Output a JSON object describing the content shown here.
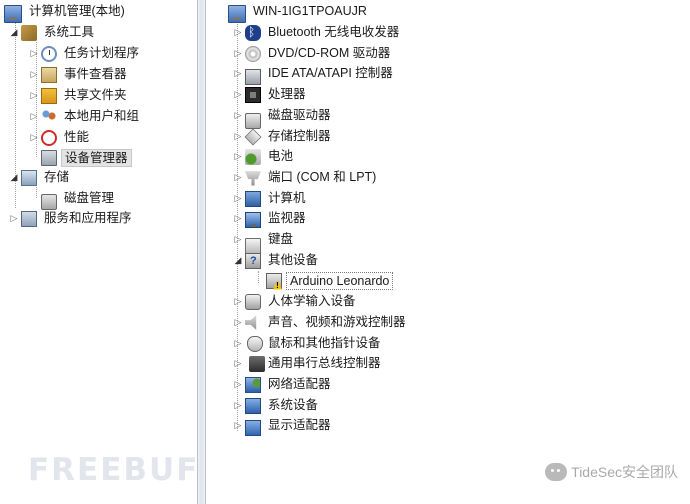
{
  "left_tree": {
    "root": "计算机管理(本地)",
    "system_tools": "系统工具",
    "task_scheduler": "任务计划程序",
    "event_viewer": "事件查看器",
    "shared_folders": "共享文件夹",
    "local_users": "本地用户和组",
    "performance": "性能",
    "device_manager": "设备管理器",
    "storage": "存储",
    "disk_management": "磁盘管理",
    "services_apps": "服务和应用程序"
  },
  "right_tree": {
    "root": "WIN-1IG1TPOAUJR",
    "categories": [
      {
        "label": "Bluetooth 无线电收发器",
        "icon": "bluetooth-icon"
      },
      {
        "label": "DVD/CD-ROM 驱动器",
        "icon": "dvd-icon"
      },
      {
        "label": "IDE ATA/ATAPI 控制器",
        "icon": "ide-controller-icon"
      },
      {
        "label": "处理器",
        "icon": "processor-icon"
      },
      {
        "label": "磁盘驱动器",
        "icon": "disk-drive-icon"
      },
      {
        "label": "存储控制器",
        "icon": "storage-controller-icon"
      },
      {
        "label": "电池",
        "icon": "battery-icon"
      },
      {
        "label": "端口 (COM 和 LPT)",
        "icon": "port-icon"
      },
      {
        "label": "计算机",
        "icon": "computer-icon"
      },
      {
        "label": "监视器",
        "icon": "monitor-icon"
      },
      {
        "label": "键盘",
        "icon": "keyboard-icon"
      },
      {
        "label": "其他设备",
        "icon": "other-devices-icon",
        "expanded": true
      },
      {
        "label": "人体学输入设备",
        "icon": "hid-icon"
      },
      {
        "label": "声音、视频和游戏控制器",
        "icon": "sound-icon"
      },
      {
        "label": "鼠标和其他指针设备",
        "icon": "mouse-icon"
      },
      {
        "label": "通用串行总线控制器",
        "icon": "usb-icon"
      },
      {
        "label": "网络适配器",
        "icon": "network-adapter-icon"
      },
      {
        "label": "系统设备",
        "icon": "system-devices-icon"
      },
      {
        "label": "显示适配器",
        "icon": "display-adapter-icon"
      }
    ],
    "other_child": "Arduino Leonardo"
  },
  "watermarks": {
    "freebuf": "FREEBUF",
    "tidesec": "TideSec安全团队"
  }
}
